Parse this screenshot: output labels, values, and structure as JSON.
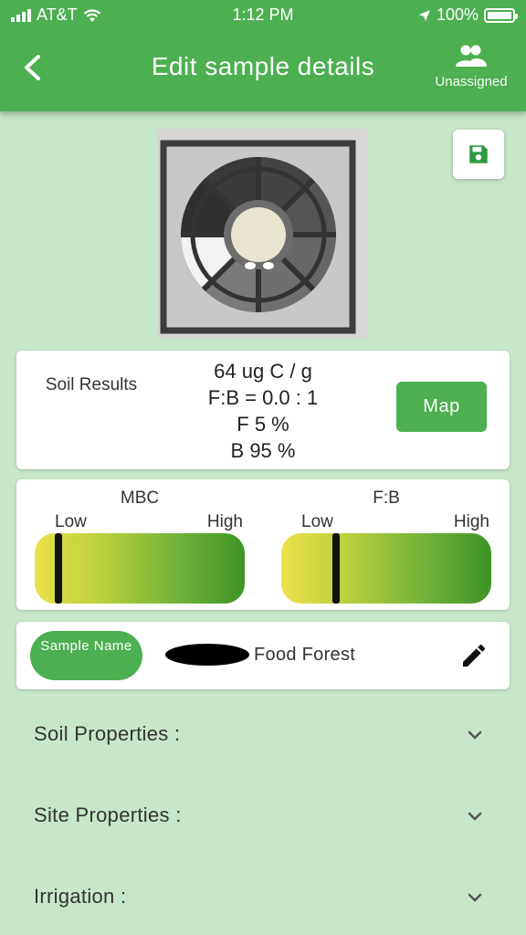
{
  "status_bar": {
    "carrier": "AT&T",
    "time": "1:12 PM",
    "battery": "100%"
  },
  "header": {
    "title": "Edit sample details",
    "assign_label": "Unassigned"
  },
  "results": {
    "label": "Soil Results",
    "values": [
      "64 ug C / g",
      "F:B = 0.0 : 1",
      "F 5 %",
      "B 95 %"
    ],
    "map_label": "Map"
  },
  "gauges": [
    {
      "title": "MBC",
      "low": "Low",
      "high": "High",
      "level": 0.1
    },
    {
      "title": "F:B",
      "low": "Low",
      "high": "High",
      "level": 0.25
    }
  ],
  "sample": {
    "pill_label": "Sample Name",
    "name": "Food Forest"
  },
  "sections": [
    {
      "label": "Soil Properties :"
    },
    {
      "label": "Site Properties :"
    },
    {
      "label": "Irrigation :"
    }
  ],
  "colors": {
    "primary": "#4caf50",
    "background": "#c8e6c9"
  }
}
